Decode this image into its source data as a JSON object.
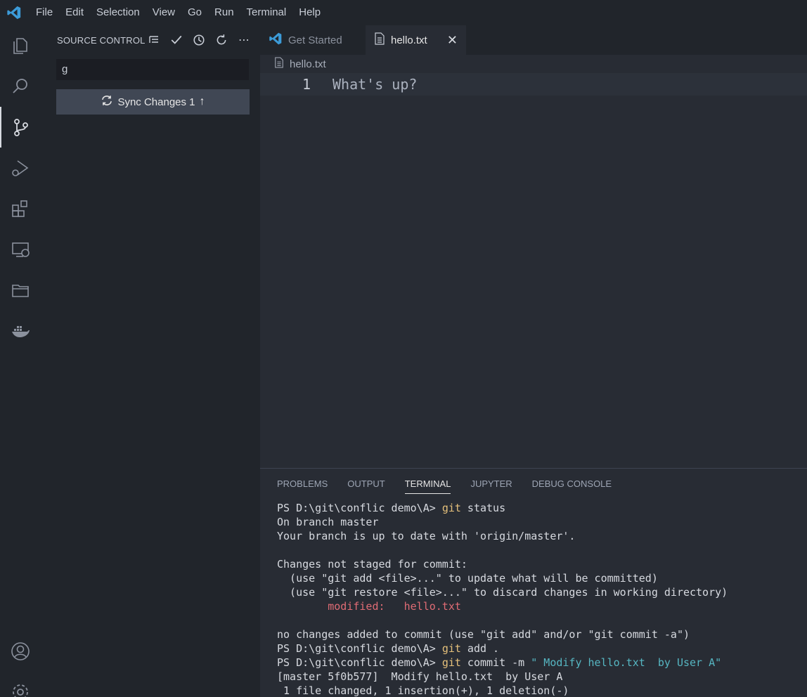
{
  "menubar": {
    "items": [
      "File",
      "Edit",
      "Selection",
      "View",
      "Go",
      "Run",
      "Terminal",
      "Help"
    ]
  },
  "activitybar": {
    "items": [
      "files-icon",
      "search-icon",
      "source-control-icon",
      "run-debug-icon",
      "extensions-icon",
      "remote-explorer-icon",
      "folder-icon",
      "docker-icon",
      "account-icon",
      "settings-gear-icon"
    ]
  },
  "sidebar": {
    "title": "SOURCE CONTROL",
    "commit_message": "g",
    "sync_button": "Sync Changes 1"
  },
  "tabs": [
    {
      "label": "Get Started",
      "active": false
    },
    {
      "label": "hello.txt",
      "active": true
    }
  ],
  "breadcrumb": {
    "file": "hello.txt"
  },
  "editor": {
    "line_number": "1",
    "code": "What's up?"
  },
  "panel": {
    "tabs": [
      "PROBLEMS",
      "OUTPUT",
      "TERMINAL",
      "JUPYTER",
      "DEBUG CONSOLE"
    ],
    "active_tab": "TERMINAL"
  },
  "terminal": {
    "prompt": "PS D:\\git\\conflic demo\\A> ",
    "lines": {
      "l1_cmd": "git",
      "l1_rest": " status",
      "l2": "On branch master",
      "l3": "Your branch is up to date with 'origin/master'.",
      "l5": "Changes not staged for commit:",
      "l6": "  (use \"git add <file>...\" to update what will be committed)",
      "l7": "  (use \"git restore <file>...\" to discard changes in working directory)",
      "l8": "        modified:   hello.txt",
      "l10": "no changes added to commit (use \"git add\" and/or \"git commit -a\")",
      "l11_cmd": "git",
      "l11_rest": " add .",
      "l12_cmd": "git",
      "l12_rest": " commit -m ",
      "l12_msg": "\" Modify hello.txt  by User A\"",
      "l13": "[master 5f0b577]  Modify hello.txt  by User A",
      "l14": " 1 file changed, 1 insertion(+), 1 deletion(-)"
    }
  },
  "colors": {
    "accent": "#3c9bd8",
    "cmd": "#e5c07b",
    "modified": "#e06c75",
    "string": "#56b6c2"
  }
}
